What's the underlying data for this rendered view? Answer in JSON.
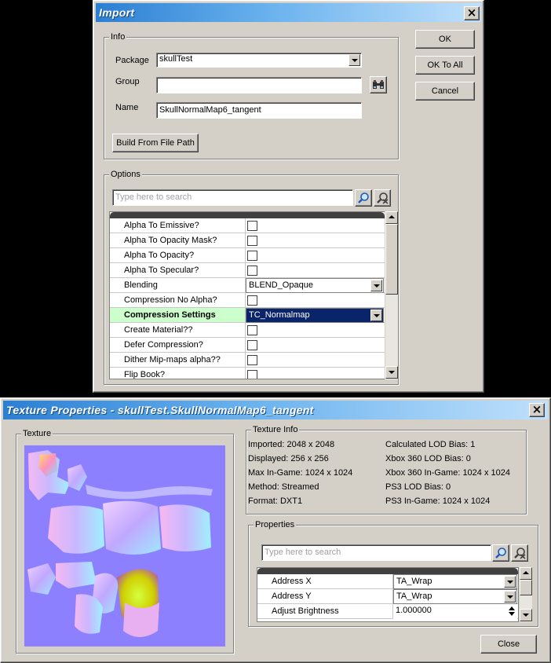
{
  "import_dialog": {
    "title": "Import",
    "close_glyph": "×",
    "info_group": "Info",
    "package_label": "Package",
    "package_value": "skullTest",
    "group_label": "Group",
    "group_value": "",
    "name_label": "Name",
    "name_value": "SkullNormalMap6_tangent",
    "build_button": "Build From File Path",
    "ok_button": "OK",
    "ok_to_all_button": "OK To All",
    "cancel_button": "Cancel",
    "options_group": "Options",
    "search_placeholder": "Type here to search",
    "options": [
      {
        "name": "Alpha  To  Emissive?",
        "type": "checkbox",
        "checked": false
      },
      {
        "name": "Alpha  To  Opacity  Mask?",
        "type": "checkbox",
        "checked": false
      },
      {
        "name": "Alpha  To  Opacity?",
        "type": "checkbox",
        "checked": false
      },
      {
        "name": "Alpha  To  Specular?",
        "type": "checkbox",
        "checked": false
      },
      {
        "name": "Blending",
        "type": "combo",
        "value": "BLEND_Opaque"
      },
      {
        "name": "Compression No Alpha?",
        "type": "checkbox",
        "checked": false
      },
      {
        "name": "Compression Settings",
        "type": "combo",
        "value": "TC_Normalmap",
        "selected": true
      },
      {
        "name": "Create  Material??",
        "type": "checkbox",
        "checked": false
      },
      {
        "name": "Defer Compression?",
        "type": "checkbox",
        "checked": false
      },
      {
        "name": "Dither  Mip-maps alpha??",
        "type": "checkbox",
        "checked": false
      },
      {
        "name": "Flip Book?",
        "type": "checkbox",
        "checked": false
      }
    ]
  },
  "texture_dialog": {
    "title": "Texture Properties - skullTest.SkullNormalMap6_tangent",
    "close_glyph": "×",
    "texture_group": "Texture",
    "info_group": "Texture Info",
    "info_left": [
      "Imported: 2048 x 2048",
      "Displayed: 256 x 256",
      "Max In-Game: 1024 x 1024",
      "Method: Streamed",
      "Format: DXT1"
    ],
    "info_right": [
      "Calculated LOD Bias: 1",
      "Xbox 360 LOD Bias: 0",
      "Xbox 360 In-Game: 1024 x 1024",
      "PS3 LOD Bias: 0",
      "PS3 In-Game: 1024 x 1024"
    ],
    "properties_group": "Properties",
    "search_placeholder": "Type here to search",
    "properties": [
      {
        "name": "Address X",
        "type": "combo",
        "value": "TA_Wrap"
      },
      {
        "name": "Address Y",
        "type": "combo",
        "value": "TA_Wrap"
      },
      {
        "name": "Adjust Brightness",
        "type": "spin",
        "value": "1.000000"
      }
    ],
    "close_button": "Close"
  },
  "colors": {
    "title_gradient_start": "#2b7fd2",
    "title_gradient_end": "#bfe0fb",
    "selection": "#0a246a",
    "highlight_row": "#ccffcc"
  }
}
